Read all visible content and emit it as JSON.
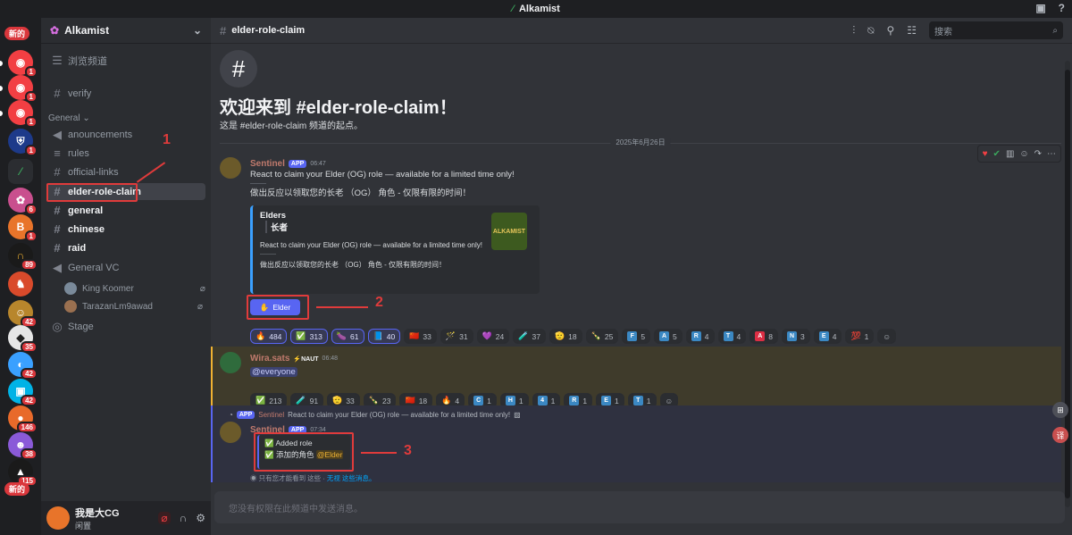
{
  "app": {
    "title": "Alkamist"
  },
  "guilds": {
    "new_label": "新的",
    "badges": [
      "1",
      "1",
      "1",
      "1",
      "1",
      "6",
      "89",
      "42",
      "35",
      "42",
      "42",
      "146",
      "38",
      "115"
    ]
  },
  "server": {
    "name": "Alkamist"
  },
  "sidebar": {
    "browse": "浏览频道",
    "verify": "verify",
    "category": "General",
    "items": [
      "anouncements",
      "rules",
      "official-links",
      "elder-role-claim",
      "general",
      "chinese",
      "raid"
    ],
    "voice": "General VC",
    "voice_users": [
      "King Koomer",
      "TarazanLm9awad"
    ],
    "stage": "Stage"
  },
  "user": {
    "name": "我是大CG",
    "status": "闲置"
  },
  "header": {
    "channel": "elder-role-claim",
    "search_placeholder": "搜索"
  },
  "welcome": {
    "title": "欢迎来到 #elder-role-claim！",
    "subtitle": "这是 #elder-role-claim 频道的起点。",
    "date": "2025年6月26日"
  },
  "msg1": {
    "author": "Sentinel",
    "app": "APP",
    "time": "06:47",
    "line1": "React to claim your Elder (OG) role — available for a limited time only!",
    "sep": "---------",
    "line2": "做出反应以领取您的长老 （OG） 角色 - 仅限有限的时间！",
    "embed": {
      "title": "Elders",
      "subtitle": "长者",
      "body1": "React to claim your Elder (OG) role — available for a limited time only!",
      "sep": "---------",
      "body2": "做出反应以领取您的长老 （OG） 角色 - 仅限有限的时间！",
      "thumb_text": "ALKAMIST"
    },
    "button": "Elder",
    "reactions": [
      {
        "icon": "🔥",
        "count": "484",
        "me": true
      },
      {
        "icon": "✅",
        "count": "313",
        "me": true
      },
      {
        "icon": "🍆",
        "count": "61",
        "me": true
      },
      {
        "icon": "📘",
        "count": "40",
        "me": true
      },
      {
        "icon": "🇨🇳",
        "count": "33"
      },
      {
        "icon": "🪄",
        "count": "31"
      },
      {
        "icon": "💜",
        "count": "24"
      },
      {
        "icon": "🧪",
        "count": "37"
      },
      {
        "icon": "🫡",
        "count": "18"
      },
      {
        "icon": "🍾",
        "count": "25"
      },
      {
        "sq": "F",
        "count": "5"
      },
      {
        "sq": "A",
        "count": "5"
      },
      {
        "sq": "R",
        "count": "4"
      },
      {
        "sq": "T",
        "count": "4"
      },
      {
        "sq": "A",
        "count": "8",
        "red": true
      },
      {
        "sq": "N",
        "count": "3"
      },
      {
        "sq": "E",
        "count": "4"
      },
      {
        "icon": "💯",
        "count": "1"
      }
    ]
  },
  "msg2": {
    "author": "Wira.sats",
    "tag": "⚡NAUT",
    "time": "06:48",
    "mention": "@everyone",
    "reactions": [
      {
        "icon": "✅",
        "count": "213"
      },
      {
        "icon": "🧪",
        "count": "91"
      },
      {
        "icon": "🫡",
        "count": "33"
      },
      {
        "icon": "🍾",
        "count": "23"
      },
      {
        "icon": "🇨🇳",
        "count": "18"
      },
      {
        "icon": "🔥",
        "count": "4"
      },
      {
        "sq": "C",
        "count": "1"
      },
      {
        "sq": "H",
        "count": "1"
      },
      {
        "sq": "4",
        "count": "1"
      },
      {
        "sq": "R",
        "count": "1"
      },
      {
        "sq": "E",
        "count": "1"
      },
      {
        "sq": "T",
        "count": "1"
      }
    ]
  },
  "msg3": {
    "reply_app": "APP",
    "reply_author": "Sentinel",
    "reply_text": "React to claim your Elder (OG) role — available for a limited time only!",
    "author": "Sentinel",
    "app": "APP",
    "time": "07:34",
    "added": "✅ Added role",
    "added_cn": "✅ 添加的角色",
    "role": "@Elder",
    "only_you": "只有您才能看到 这些 ·",
    "dismiss": "无视 这些消息。"
  },
  "annotations": {
    "n1": "1",
    "n2": "2",
    "n3": "3"
  },
  "composer": {
    "placeholder": "您没有权限在此频道中发送消息。"
  }
}
